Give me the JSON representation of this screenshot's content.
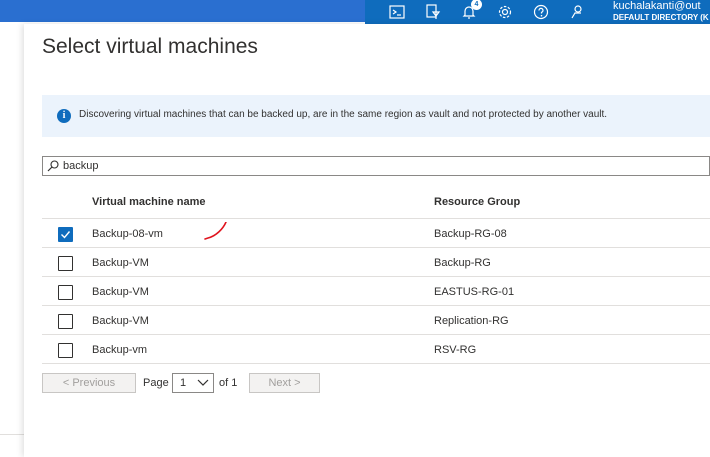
{
  "account": {
    "name": "kuchalakanti@out",
    "directory": "DEFAULT DIRECTORY (K"
  },
  "header_icons": {
    "notification_count": "4",
    "items": [
      "cloud-shell-icon",
      "directory-filter-icon",
      "notifications-icon",
      "settings-icon",
      "help-icon",
      "feedback-icon"
    ]
  },
  "panel": {
    "title": "Select virtual machines",
    "info_message": "Discovering virtual machines that can be backed up, are in the same region as vault and not protected by another vault.",
    "search": {
      "value": "backup"
    },
    "table": {
      "columns": [
        "Virtual machine name",
        "Resource Group"
      ],
      "rows": [
        {
          "name": "Backup-08-vm",
          "resource_group": "Backup-RG-08",
          "selected": true
        },
        {
          "name": "Backup-VM",
          "resource_group": "Backup-RG",
          "selected": false
        },
        {
          "name": "Backup-VM",
          "resource_group": "EASTUS-RG-01",
          "selected": false
        },
        {
          "name": "Backup-VM",
          "resource_group": "Replication-RG",
          "selected": false
        },
        {
          "name": "Backup-vm",
          "resource_group": "RSV-RG",
          "selected": false
        }
      ]
    },
    "pagination": {
      "previous_label": "< Previous",
      "page_label": "Page",
      "current_page": "1",
      "of_label": "of 1",
      "next_label": "Next >"
    }
  },
  "colors": {
    "accent": "#0f6cbd",
    "annotation": "#e0141e",
    "info_bg": "#ebf3fc"
  }
}
